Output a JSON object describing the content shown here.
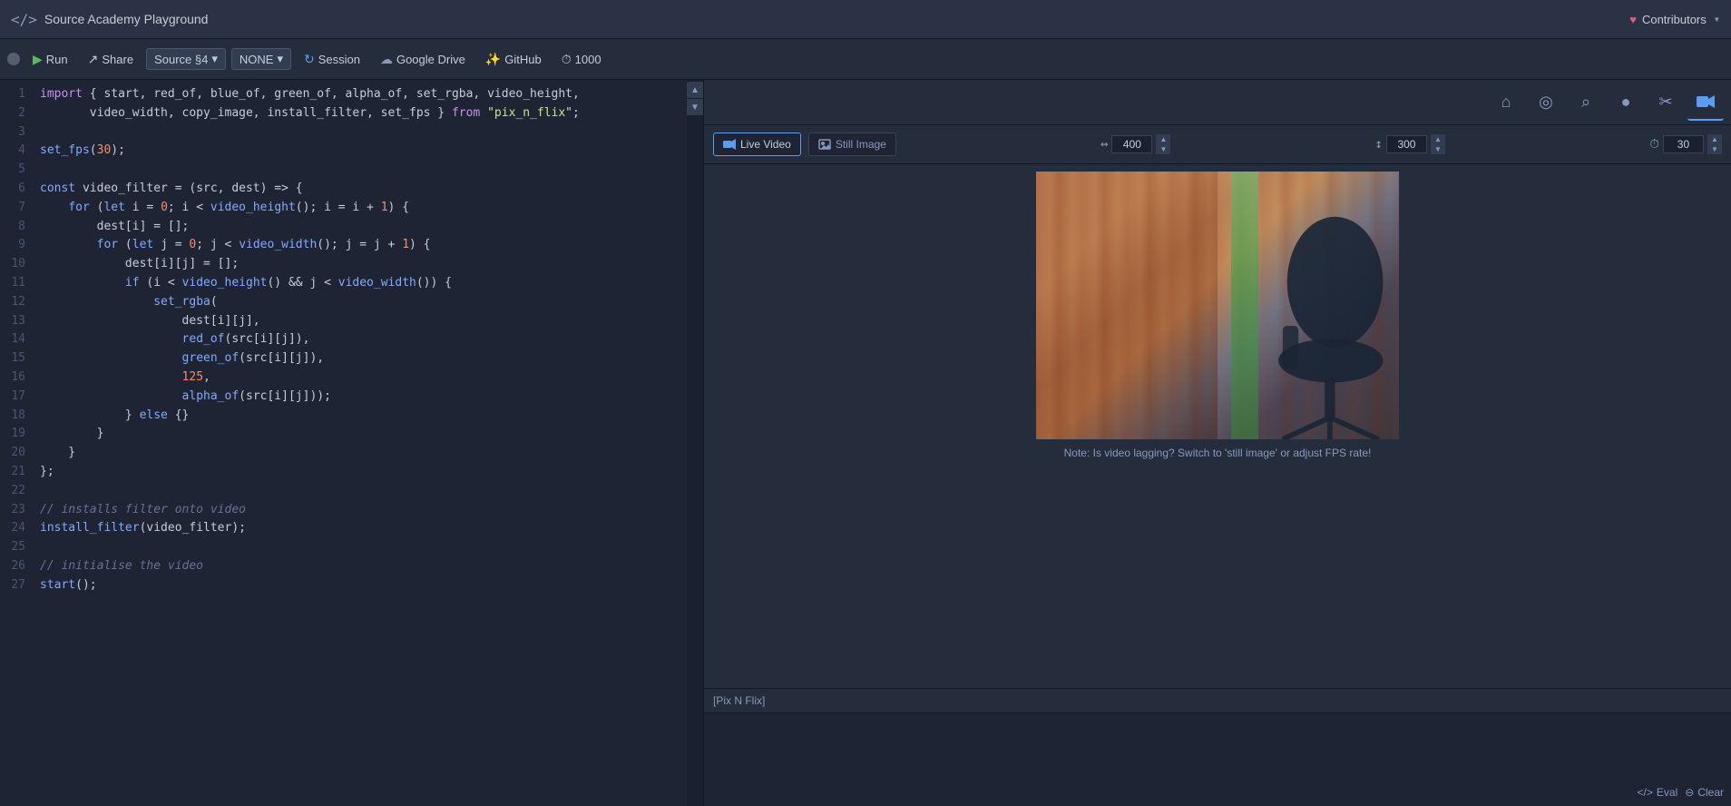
{
  "titleBar": {
    "appTitle": "Source Academy Playground",
    "contributorsLabel": "Contributors"
  },
  "toolbar": {
    "runLabel": "Run",
    "shareLabel": "Share",
    "sourceLabel": "Source §4",
    "noneLabel": "NONE",
    "sessionLabel": "Session",
    "googleDriveLabel": "Google Drive",
    "githubLabel": "GitHub",
    "stepCount": "1000"
  },
  "rightToolbar": {
    "icons": [
      "home",
      "eye",
      "search",
      "globe",
      "scissors",
      "video"
    ]
  },
  "videoControls": {
    "liveVideoLabel": "Live Video",
    "stillImageLabel": "Still Image",
    "widthLabel": "400",
    "heightLabel": "300",
    "fpsLabel": "30"
  },
  "videoNote": "Note: Is video lagging? Switch to 'still image' or adjust FPS rate!",
  "repl": {
    "header": "[Pix N Flix]",
    "evalLabel": "Eval",
    "clearLabel": "Clear"
  },
  "code": {
    "lines": [
      {
        "num": 1,
        "tokens": [
          {
            "t": "kw",
            "v": "import"
          },
          {
            "t": "plain",
            "v": " { start, red_of, blue_of, green_of, alpha_of, set_rgba, video_height,"
          }
        ]
      },
      {
        "num": 2,
        "tokens": [
          {
            "t": "plain",
            "v": "       video_width, copy_image, install_filter, set_fps } "
          },
          {
            "t": "from-kw",
            "v": "from"
          },
          {
            "t": "plain",
            "v": " "
          },
          {
            "t": "str",
            "v": "\"pix_n_flix\""
          },
          {
            "t": "plain",
            "v": ";"
          }
        ]
      },
      {
        "num": 3,
        "tokens": [
          {
            "t": "plain",
            "v": ""
          }
        ]
      },
      {
        "num": 4,
        "tokens": [
          {
            "t": "fn",
            "v": "set_fps"
          },
          {
            "t": "plain",
            "v": "("
          },
          {
            "t": "num",
            "v": "30"
          },
          {
            "t": "plain",
            "v": ");"
          }
        ]
      },
      {
        "num": 5,
        "tokens": [
          {
            "t": "plain",
            "v": ""
          }
        ]
      },
      {
        "num": 6,
        "tokens": [
          {
            "t": "kw2",
            "v": "const"
          },
          {
            "t": "plain",
            "v": " video_filter = (src, dest) => {"
          }
        ]
      },
      {
        "num": 7,
        "tokens": [
          {
            "t": "plain",
            "v": "    "
          },
          {
            "t": "kw2",
            "v": "for"
          },
          {
            "t": "plain",
            "v": " ("
          },
          {
            "t": "kw2",
            "v": "let"
          },
          {
            "t": "plain",
            "v": " i = "
          },
          {
            "t": "num",
            "v": "0"
          },
          {
            "t": "plain",
            "v": "; i < "
          },
          {
            "t": "fn",
            "v": "video_height"
          },
          {
            "t": "plain",
            "v": "(); i = i + "
          },
          {
            "t": "num",
            "v": "1"
          },
          {
            "t": "plain",
            "v": ") {"
          }
        ]
      },
      {
        "num": 8,
        "tokens": [
          {
            "t": "plain",
            "v": "        dest[i] = [];"
          }
        ]
      },
      {
        "num": 9,
        "tokens": [
          {
            "t": "plain",
            "v": "        "
          },
          {
            "t": "kw2",
            "v": "for"
          },
          {
            "t": "plain",
            "v": " ("
          },
          {
            "t": "kw2",
            "v": "let"
          },
          {
            "t": "plain",
            "v": " j = "
          },
          {
            "t": "num",
            "v": "0"
          },
          {
            "t": "plain",
            "v": "; j < "
          },
          {
            "t": "fn",
            "v": "video_width"
          },
          {
            "t": "plain",
            "v": "(); j = j + "
          },
          {
            "t": "num",
            "v": "1"
          },
          {
            "t": "plain",
            "v": ") {"
          }
        ]
      },
      {
        "num": 10,
        "tokens": [
          {
            "t": "plain",
            "v": "            dest[i][j] = [];"
          }
        ]
      },
      {
        "num": 11,
        "tokens": [
          {
            "t": "plain",
            "v": "            "
          },
          {
            "t": "kw2",
            "v": "if"
          },
          {
            "t": "plain",
            "v": " (i < "
          },
          {
            "t": "fn",
            "v": "video_height"
          },
          {
            "t": "plain",
            "v": "() && j < "
          },
          {
            "t": "fn",
            "v": "video_width"
          },
          {
            "t": "plain",
            "v": "()) {"
          }
        ]
      },
      {
        "num": 12,
        "tokens": [
          {
            "t": "plain",
            "v": "                "
          },
          {
            "t": "fn",
            "v": "set_rgba"
          },
          {
            "t": "plain",
            "v": "("
          }
        ]
      },
      {
        "num": 13,
        "tokens": [
          {
            "t": "plain",
            "v": "                    dest[i][j],"
          }
        ]
      },
      {
        "num": 14,
        "tokens": [
          {
            "t": "plain",
            "v": "                    "
          },
          {
            "t": "fn",
            "v": "red_of"
          },
          {
            "t": "plain",
            "v": "(src[i][j]),"
          }
        ]
      },
      {
        "num": 15,
        "tokens": [
          {
            "t": "plain",
            "v": "                    "
          },
          {
            "t": "fn",
            "v": "green_of"
          },
          {
            "t": "plain",
            "v": "(src[i][j]),"
          }
        ]
      },
      {
        "num": 16,
        "tokens": [
          {
            "t": "plain",
            "v": "                    "
          },
          {
            "t": "num",
            "v": "125"
          },
          {
            "t": "plain",
            "v": ","
          }
        ]
      },
      {
        "num": 17,
        "tokens": [
          {
            "t": "plain",
            "v": "                    "
          },
          {
            "t": "fn",
            "v": "alpha_of"
          },
          {
            "t": "plain",
            "v": "(src[i][j]));"
          }
        ]
      },
      {
        "num": 18,
        "tokens": [
          {
            "t": "plain",
            "v": "            } "
          },
          {
            "t": "kw2",
            "v": "else"
          },
          {
            "t": "plain",
            "v": " {}"
          }
        ]
      },
      {
        "num": 19,
        "tokens": [
          {
            "t": "plain",
            "v": "        }"
          }
        ]
      },
      {
        "num": 20,
        "tokens": [
          {
            "t": "plain",
            "v": "    }"
          }
        ]
      },
      {
        "num": 21,
        "tokens": [
          {
            "t": "plain",
            "v": "};"
          }
        ]
      },
      {
        "num": 22,
        "tokens": [
          {
            "t": "plain",
            "v": ""
          }
        ]
      },
      {
        "num": 23,
        "tokens": [
          {
            "t": "comment",
            "v": "// installs filter onto video"
          }
        ]
      },
      {
        "num": 24,
        "tokens": [
          {
            "t": "fn",
            "v": "install_filter"
          },
          {
            "t": "plain",
            "v": "(video_filter);"
          }
        ]
      },
      {
        "num": 25,
        "tokens": [
          {
            "t": "plain",
            "v": ""
          }
        ]
      },
      {
        "num": 26,
        "tokens": [
          {
            "t": "comment",
            "v": "// initialise the video"
          }
        ]
      },
      {
        "num": 27,
        "tokens": [
          {
            "t": "fn",
            "v": "start"
          },
          {
            "t": "plain",
            "v": "();"
          }
        ]
      }
    ]
  }
}
